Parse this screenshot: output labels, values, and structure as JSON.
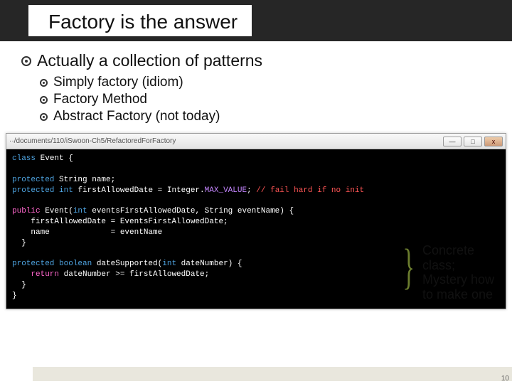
{
  "title": "Factory is the answer",
  "bullets": {
    "main": "Actually a collection of patterns",
    "subs": [
      "Simply factory (idiom)",
      "Factory Method",
      "Abstract Factory (not today)"
    ]
  },
  "window": {
    "path": "··/documents/110/iSwoon-Ch5/RefactoredForFactory",
    "btn_min": "—",
    "btn_max": "□",
    "btn_close": "x"
  },
  "code": {
    "l1a": "class",
    "l1b": " Event {",
    "l2a": "protected",
    "l2b": " String name;",
    "l3a": "protected int",
    "l3b": " firstAllowedDate = Integer.",
    "l3c": "MAX_VALUE",
    "l3d": ";",
    "l3e": " // fail hard if no init",
    "l4a": "public",
    "l4b": " Event(",
    "l4c": "int",
    "l4d": " eventsFirstAllowedDate, String eventName) {",
    "l5": "    firstAllowedDate = EventsFirstAllowedDate;",
    "l6": "    name             = eventName",
    "l7": "  }",
    "l8a": "protected boolean",
    "l8b": " dateSupported(",
    "l8c": "int",
    "l8d": " dateNumber) {",
    "l9a": "    return",
    "l9b": " dateNumber >= firstAllowedDate;",
    "l10": "  }",
    "l11": "}"
  },
  "annotation": "Concrete class; Mystery how to make one",
  "brace": "}",
  "page": "10"
}
